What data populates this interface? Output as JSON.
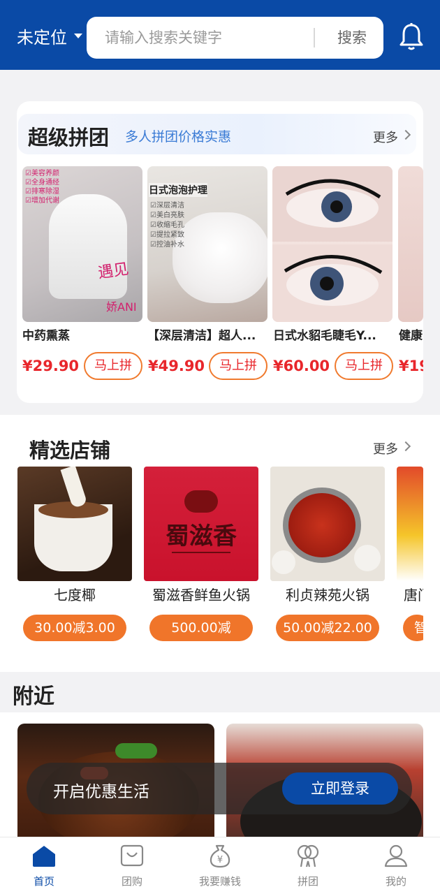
{
  "header": {
    "location": "未定位",
    "search_placeholder": "请输入搜索关键字",
    "search_button": "搜索"
  },
  "super_group": {
    "title": "超级拼团",
    "subtitle": "多人拼团价格实惠",
    "more": "更多",
    "join_label": "马上拼",
    "products": [
      {
        "name": "中药熏蒸",
        "price": "¥29.90"
      },
      {
        "name": "【深层清洁】超人...",
        "price": "¥49.90"
      },
      {
        "name": "日式水貂毛睫毛Y...",
        "price": "¥60.00"
      },
      {
        "name": "健康",
        "price": "¥19"
      }
    ],
    "image_texts": {
      "p1": [
        "☑美容养颜",
        "☑全身通经",
        "☑排寒除湿",
        "☑增加代谢",
        "遇见",
        "娇ANI"
      ],
      "p2": [
        "日式泡泡护理",
        "☑深层清洁",
        "☑美白亮肤",
        "☑收缩毛孔",
        "☑提拉紧致",
        "☑控油补水"
      ]
    }
  },
  "shops": {
    "title": "精选店铺",
    "more": "更多",
    "items": [
      {
        "name": "七度椰",
        "tag": "30.00减3.00"
      },
      {
        "name": "蜀滋香鲜鱼火锅",
        "tag": "500.00减"
      },
      {
        "name": "利贞辣苑火锅",
        "tag": "50.00减22.00"
      },
      {
        "name": "唐门",
        "tag": "智"
      }
    ],
    "sign_text": "蜀滋香"
  },
  "nearby": {
    "title": "附近",
    "overlay_text": "开启优惠生活",
    "login_button": "立即登录"
  },
  "tabbar": {
    "items": [
      {
        "label": "首页",
        "icon": "home-icon"
      },
      {
        "label": "团购",
        "icon": "bag-icon"
      },
      {
        "label": "我要赚钱",
        "icon": "money-bag-icon"
      },
      {
        "label": "拼团",
        "icon": "group-icon"
      },
      {
        "label": "我的",
        "icon": "user-icon"
      }
    ],
    "active_color": "#0a4aa6"
  },
  "colors": {
    "brand": "#0a4aa6",
    "price": "#e8262b",
    "tag": "#f0752a"
  }
}
